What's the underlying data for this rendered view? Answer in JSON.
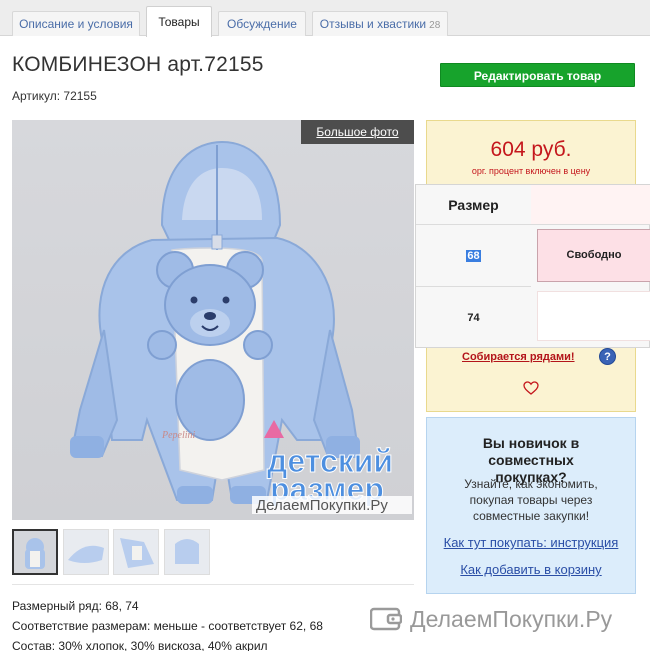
{
  "tabs": [
    {
      "label": "Описание и условия"
    },
    {
      "label": "Товары",
      "active": true
    },
    {
      "label": "Обсуждение"
    },
    {
      "label": "Отзывы и хвастики",
      "count": "28"
    }
  ],
  "product": {
    "title": "КОМБИНЕЗОН арт.72155",
    "article": "Артикул: 72155",
    "edit_button": "Редактировать товар",
    "big_photo_label": "Большое фото",
    "photo_watermark_line1": "детский",
    "photo_watermark_line2": "размер",
    "photo_watermark_site": "ДелаемПокупки.Ру",
    "brand_embroidery": "Pepelini"
  },
  "price": {
    "amount": "604 руб.",
    "note": "орг. процент включен в цену",
    "rows_link": "Собирается рядами!",
    "help_icon": "?"
  },
  "size_table": {
    "header": "Размер",
    "rows": [
      {
        "size": "68",
        "status": "Свободно"
      },
      {
        "size": "74",
        "status": ""
      }
    ]
  },
  "specs": {
    "line1": "Размерный ряд: 68, 74",
    "line2": "Соответствие размерам: меньше - соответствует 62, 68",
    "line3": "Состав: 30% хлопок, 30% вискоза, 40% акрил"
  },
  "newbie": {
    "title": "Вы новичок в совместных покупках?",
    "text": "Узнайте, как экономить, покупая товары через совместные закупки!",
    "link1": "Как тут покупать: инструкция",
    "link2": "Как добавить в корзину"
  },
  "watermark": {
    "text": "ДелаемПокупки.Ру"
  },
  "colors": {
    "accent_green": "#17a32c",
    "price_red": "#c4161c",
    "link_blue": "#2a4ea6",
    "price_box_bg": "#fbf3d2",
    "info_box_bg": "#dcedfb"
  }
}
